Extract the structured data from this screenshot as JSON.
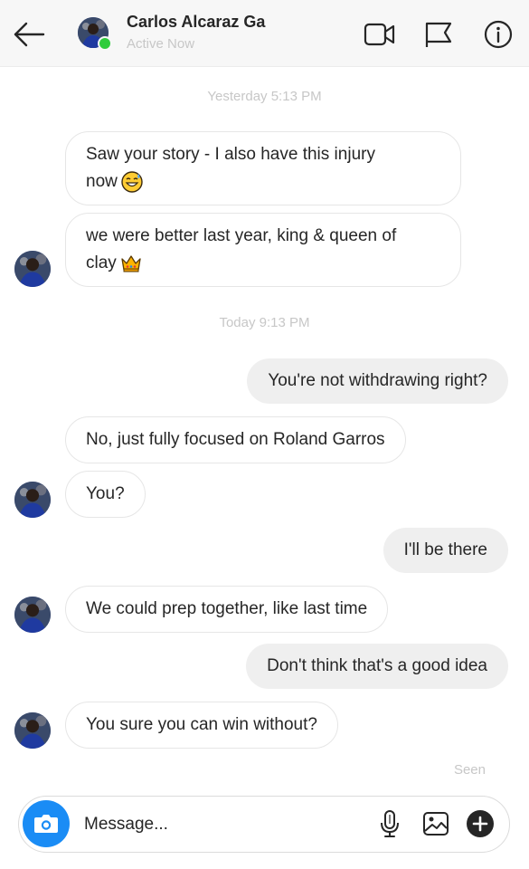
{
  "header": {
    "contact_name": "Carlos Alcaraz Ga",
    "status": "Active Now"
  },
  "conversation": {
    "timestamps": [
      "Yesterday 5:13 PM",
      "Today 9:13 PM"
    ],
    "messages": [
      {
        "sender": "them",
        "text": "Saw your story - I also have this injury",
        "text2": "now",
        "emoji": "sweat-smile-emoji"
      },
      {
        "sender": "them",
        "text": "we were better last year, king & queen of",
        "text2": "clay",
        "emoji": "crown-emoji"
      },
      {
        "sender": "me",
        "text": "You're not withdrawing right?"
      },
      {
        "sender": "them",
        "text": "No, just fully focused on Roland Garros"
      },
      {
        "sender": "them",
        "text": "You?"
      },
      {
        "sender": "me",
        "text": "I'll be there"
      },
      {
        "sender": "them",
        "text": "We could prep together, like last time"
      },
      {
        "sender": "me",
        "text": "Don't think that's a good idea"
      },
      {
        "sender": "them",
        "text": "You sure you can win without?"
      }
    ],
    "seen_label": "Seen"
  },
  "composer": {
    "placeholder": "Message...",
    "icons": [
      "camera-icon",
      "microphone-icon",
      "image-icon",
      "plus-icon"
    ]
  },
  "colors": {
    "accent": "#1a8cf5",
    "online": "#2fcc3c",
    "outgoing_bubble": "#efefef",
    "muted_text": "#c7c7c7"
  }
}
